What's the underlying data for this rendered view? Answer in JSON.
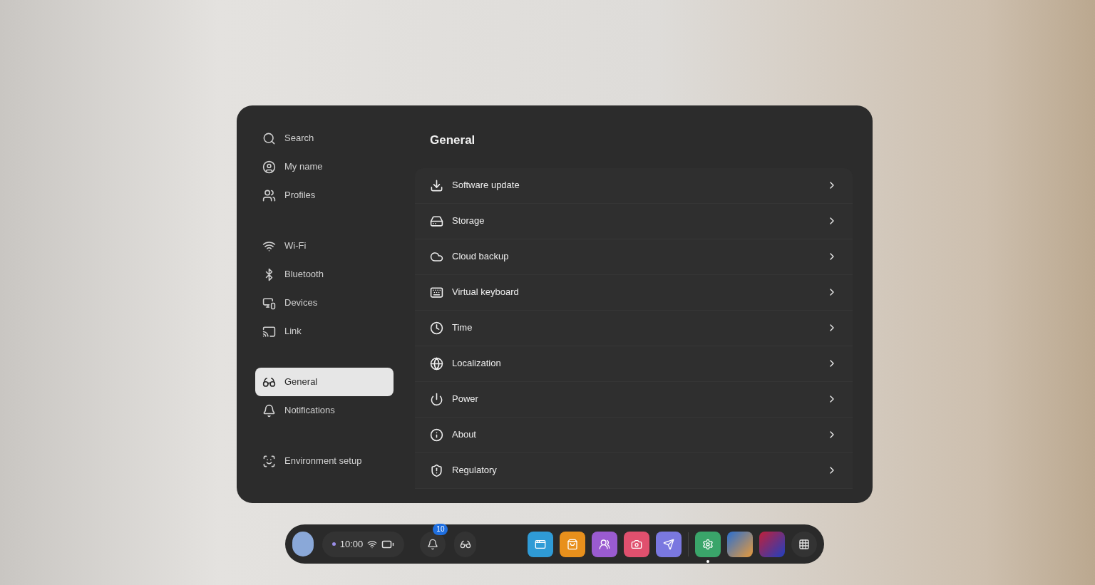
{
  "sidebar": {
    "groups": [
      {
        "items": [
          {
            "label": "Search",
            "selected": false
          },
          {
            "label": "My name",
            "selected": false
          },
          {
            "label": "Profiles",
            "selected": false
          }
        ]
      },
      {
        "items": [
          {
            "label": "Wi-Fi",
            "selected": false
          },
          {
            "label": "Bluetooth",
            "selected": false
          },
          {
            "label": "Devices",
            "selected": false
          },
          {
            "label": "Link",
            "selected": false
          }
        ]
      },
      {
        "items": [
          {
            "label": "General",
            "selected": true
          },
          {
            "label": "Notifications",
            "selected": false
          }
        ]
      },
      {
        "items": [
          {
            "label": "Environment setup",
            "selected": false
          }
        ]
      }
    ]
  },
  "content": {
    "title": "General",
    "items": [
      {
        "label": "Software update"
      },
      {
        "label": "Storage"
      },
      {
        "label": "Cloud backup"
      },
      {
        "label": "Virtual keyboard"
      },
      {
        "label": "Time"
      },
      {
        "label": "Localization"
      },
      {
        "label": "Power"
      },
      {
        "label": "About"
      },
      {
        "label": "Regulatory"
      }
    ]
  },
  "taskbar": {
    "time": "10:00",
    "notification_count": "10",
    "apps": [
      {
        "color": "#2f9bd6",
        "selected": false
      },
      {
        "color": "#e8901c",
        "selected": false
      },
      {
        "color": "#9a5bd0",
        "selected": false
      },
      {
        "color": "#e0506e",
        "selected": false
      },
      {
        "color": "#7a78e0",
        "selected": false
      },
      {
        "color": "#3aa56a",
        "selected": true
      }
    ]
  }
}
